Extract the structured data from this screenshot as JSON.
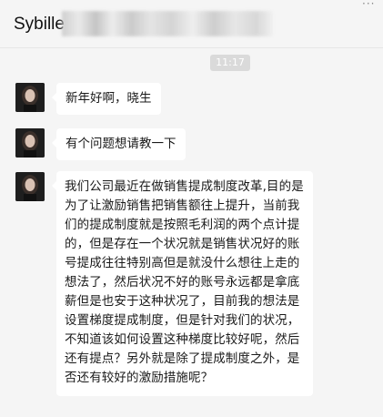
{
  "header": {
    "contact_name": "Sybille"
  },
  "timestamp": "11:17",
  "messages": [
    {
      "text": "新年好啊，晓生"
    },
    {
      "text": "有个问题想请教一下"
    },
    {
      "text": "我们公司最近在做销售提成制度改革,目的是为了让激励销售把销售额往上提升，当前我们的提成制度就是按照毛利润的两个点计提的，但是存在一个状况就是销售状况好的账号提成往往特别高但是就没什么想往上走的想法了，然后状况不好的账号永远都是拿底薪但是也安于这种状况了，目前我的想法是设置梯度提成制度，但是针对我们的状况，不知道该如何设置这种梯度比较好呢，然后还有提点？另外就是除了提成制度之外，是否还有较好的激励措施呢？"
    }
  ],
  "icons": {
    "more": "more-dots-icon",
    "avatar": "contact-avatar"
  }
}
